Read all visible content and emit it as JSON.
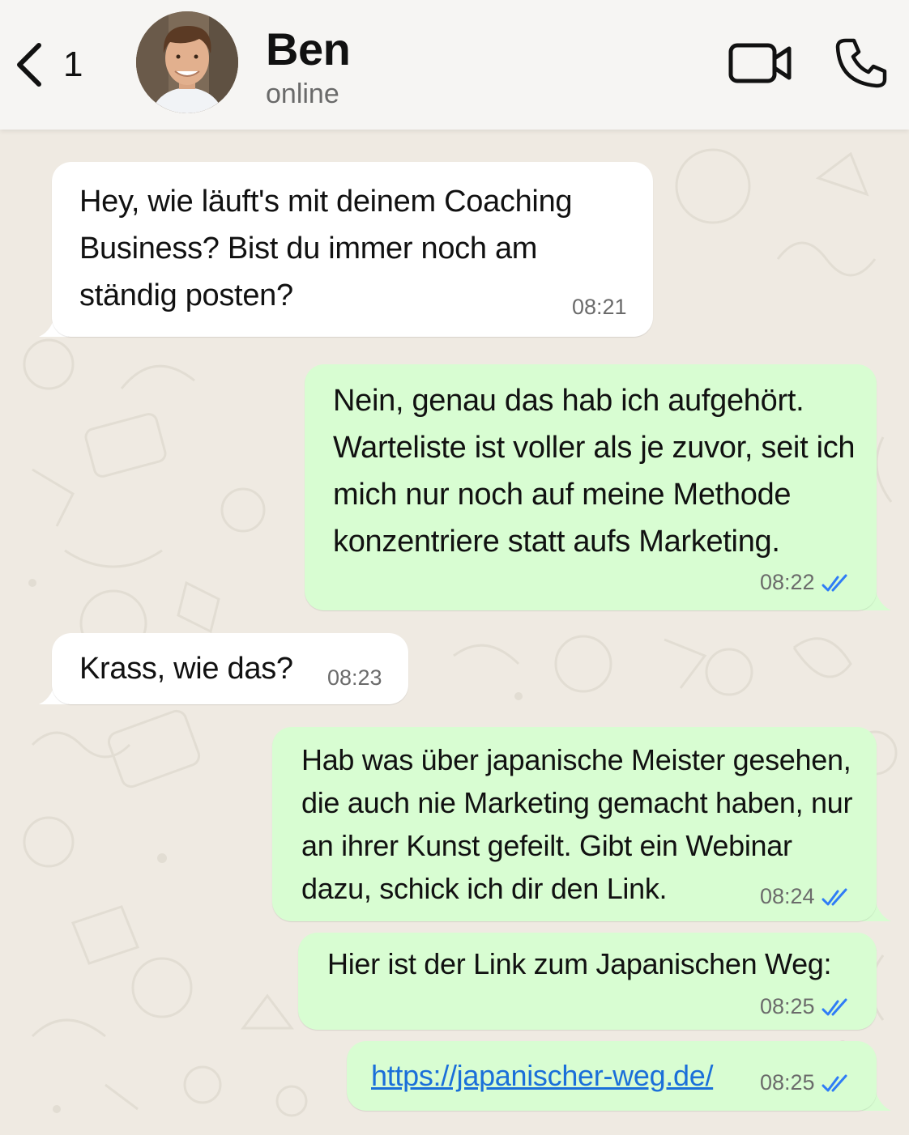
{
  "header": {
    "back_label": "<",
    "unread_count": "1",
    "contact_name": "Ben",
    "contact_status": "online"
  },
  "colors": {
    "incoming_bubble": "#ffffff",
    "outgoing_bubble": "#d8fdd2",
    "read_ticks": "#2f7cf6",
    "link": "#1a6fd9",
    "background": "#efeae2"
  },
  "messages": [
    {
      "direction": "incoming",
      "text": "Hey, wie läuft's mit deinem Coaching Business? Bist du immer noch am ständig posten?",
      "time": "08:21"
    },
    {
      "direction": "outgoing",
      "text": "Nein, genau das hab ich aufgehört. Warteliste ist voller als je zuvor, seit ich mich nur noch auf meine Methode konzentriere statt aufs Marketing.",
      "time": "08:22",
      "status": "read"
    },
    {
      "direction": "incoming",
      "text": "Krass, wie das?",
      "time": "08:23"
    },
    {
      "direction": "outgoing",
      "text": "Hab was über japanische Meister gesehen, die auch nie Marketing gemacht haben, nur an ihrer Kunst gefeilt. Gibt ein Webinar dazu, schick ich dir den Link.",
      "time": "08:24",
      "status": "read"
    },
    {
      "direction": "outgoing",
      "text": "Hier ist der Link zum Japanischen Weg:",
      "time": "08:25",
      "status": "read"
    },
    {
      "direction": "outgoing",
      "text": "https://japanischer-weg.de/",
      "time": "08:25",
      "status": "read",
      "is_link": true
    }
  ],
  "icons": {
    "back": "chevron-left-icon",
    "video": "video-camera-icon",
    "call": "phone-icon",
    "read_receipt": "double-check-icon"
  }
}
